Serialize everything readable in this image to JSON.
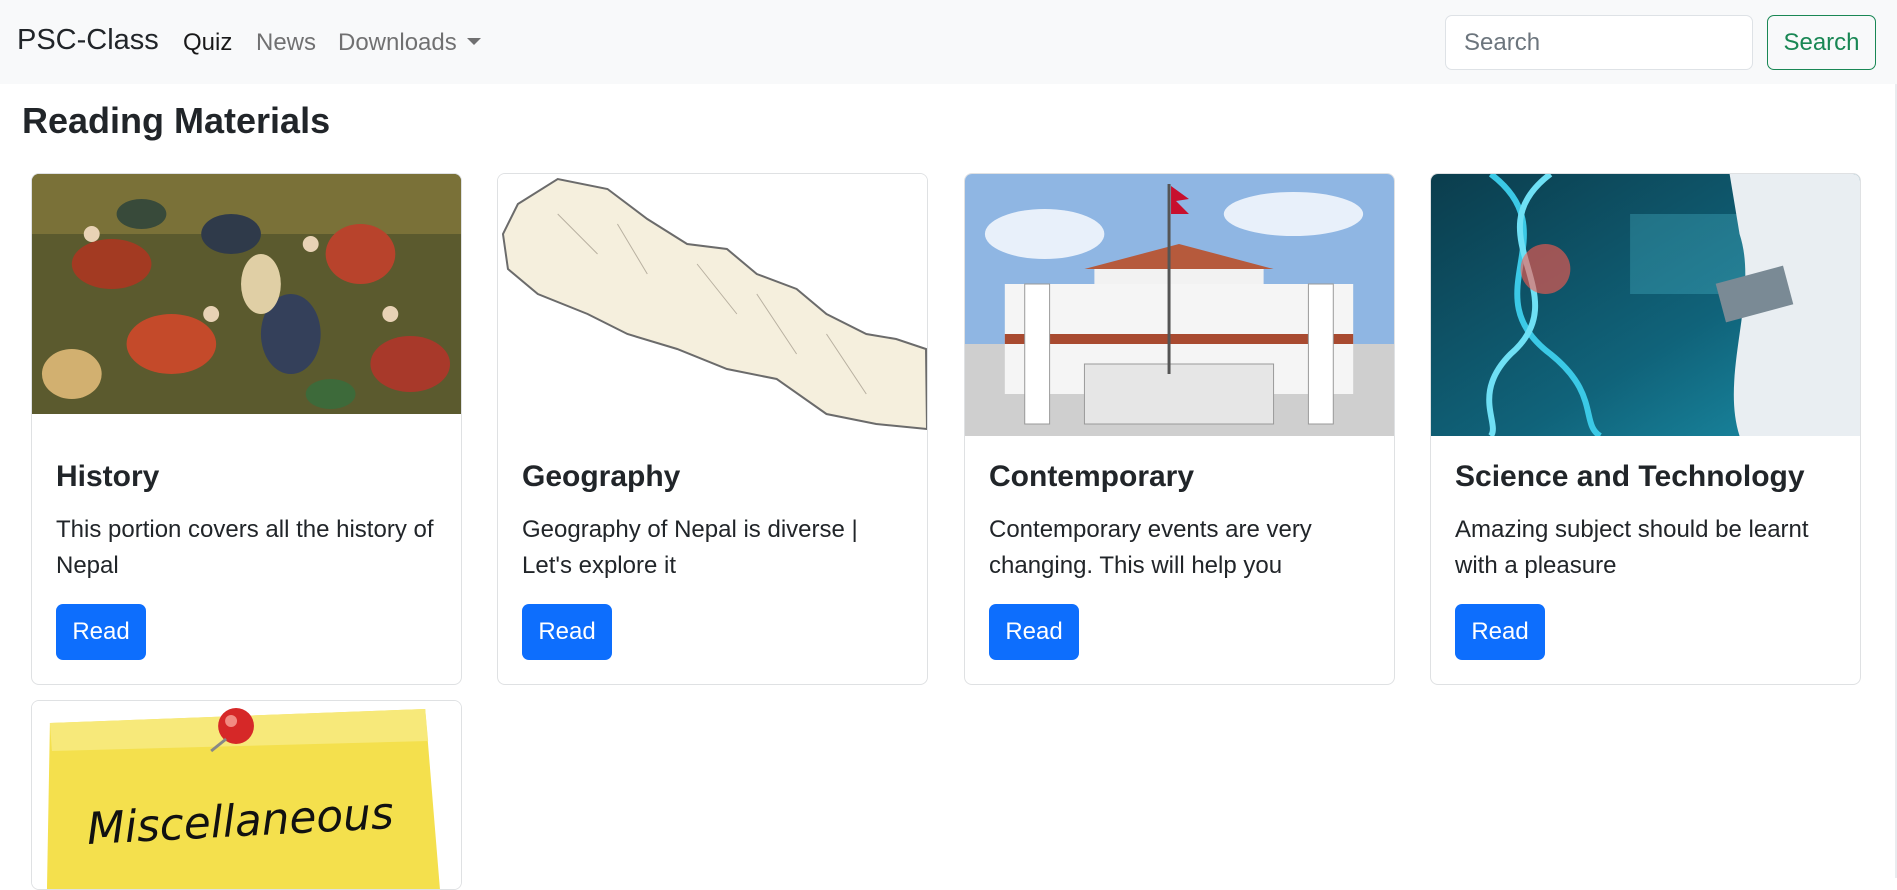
{
  "navbar": {
    "brand": "PSC-Class",
    "links": [
      {
        "label": "Quiz"
      },
      {
        "label": "News"
      },
      {
        "label": "Downloads"
      }
    ],
    "search": {
      "placeholder": "Search",
      "button_label": "Search"
    }
  },
  "page": {
    "title": "Reading Materials"
  },
  "cards": [
    {
      "title": "History",
      "text": "This portion covers all the history of Nepal",
      "button": "Read",
      "image": "battle-painting"
    },
    {
      "title": "Geography",
      "text": "Geography of Nepal is diverse | Let's explore it",
      "button": "Read",
      "image": "nepal-map"
    },
    {
      "title": "Contemporary",
      "text": "Contemporary events are very changing. This will help you",
      "button": "Read",
      "image": "parliament-building"
    },
    {
      "title": "Science and Technology",
      "text": "Amazing subject should be learnt with a pleasure",
      "button": "Read",
      "image": "dna-technology"
    },
    {
      "title": "",
      "text": "",
      "button": "",
      "image": "sticky-note-miscellaneous",
      "image_text": "Miscellaneous"
    }
  ],
  "colors": {
    "primary": "#0d6efd",
    "success": "#198754",
    "navbar_bg": "#f8f9fa"
  }
}
